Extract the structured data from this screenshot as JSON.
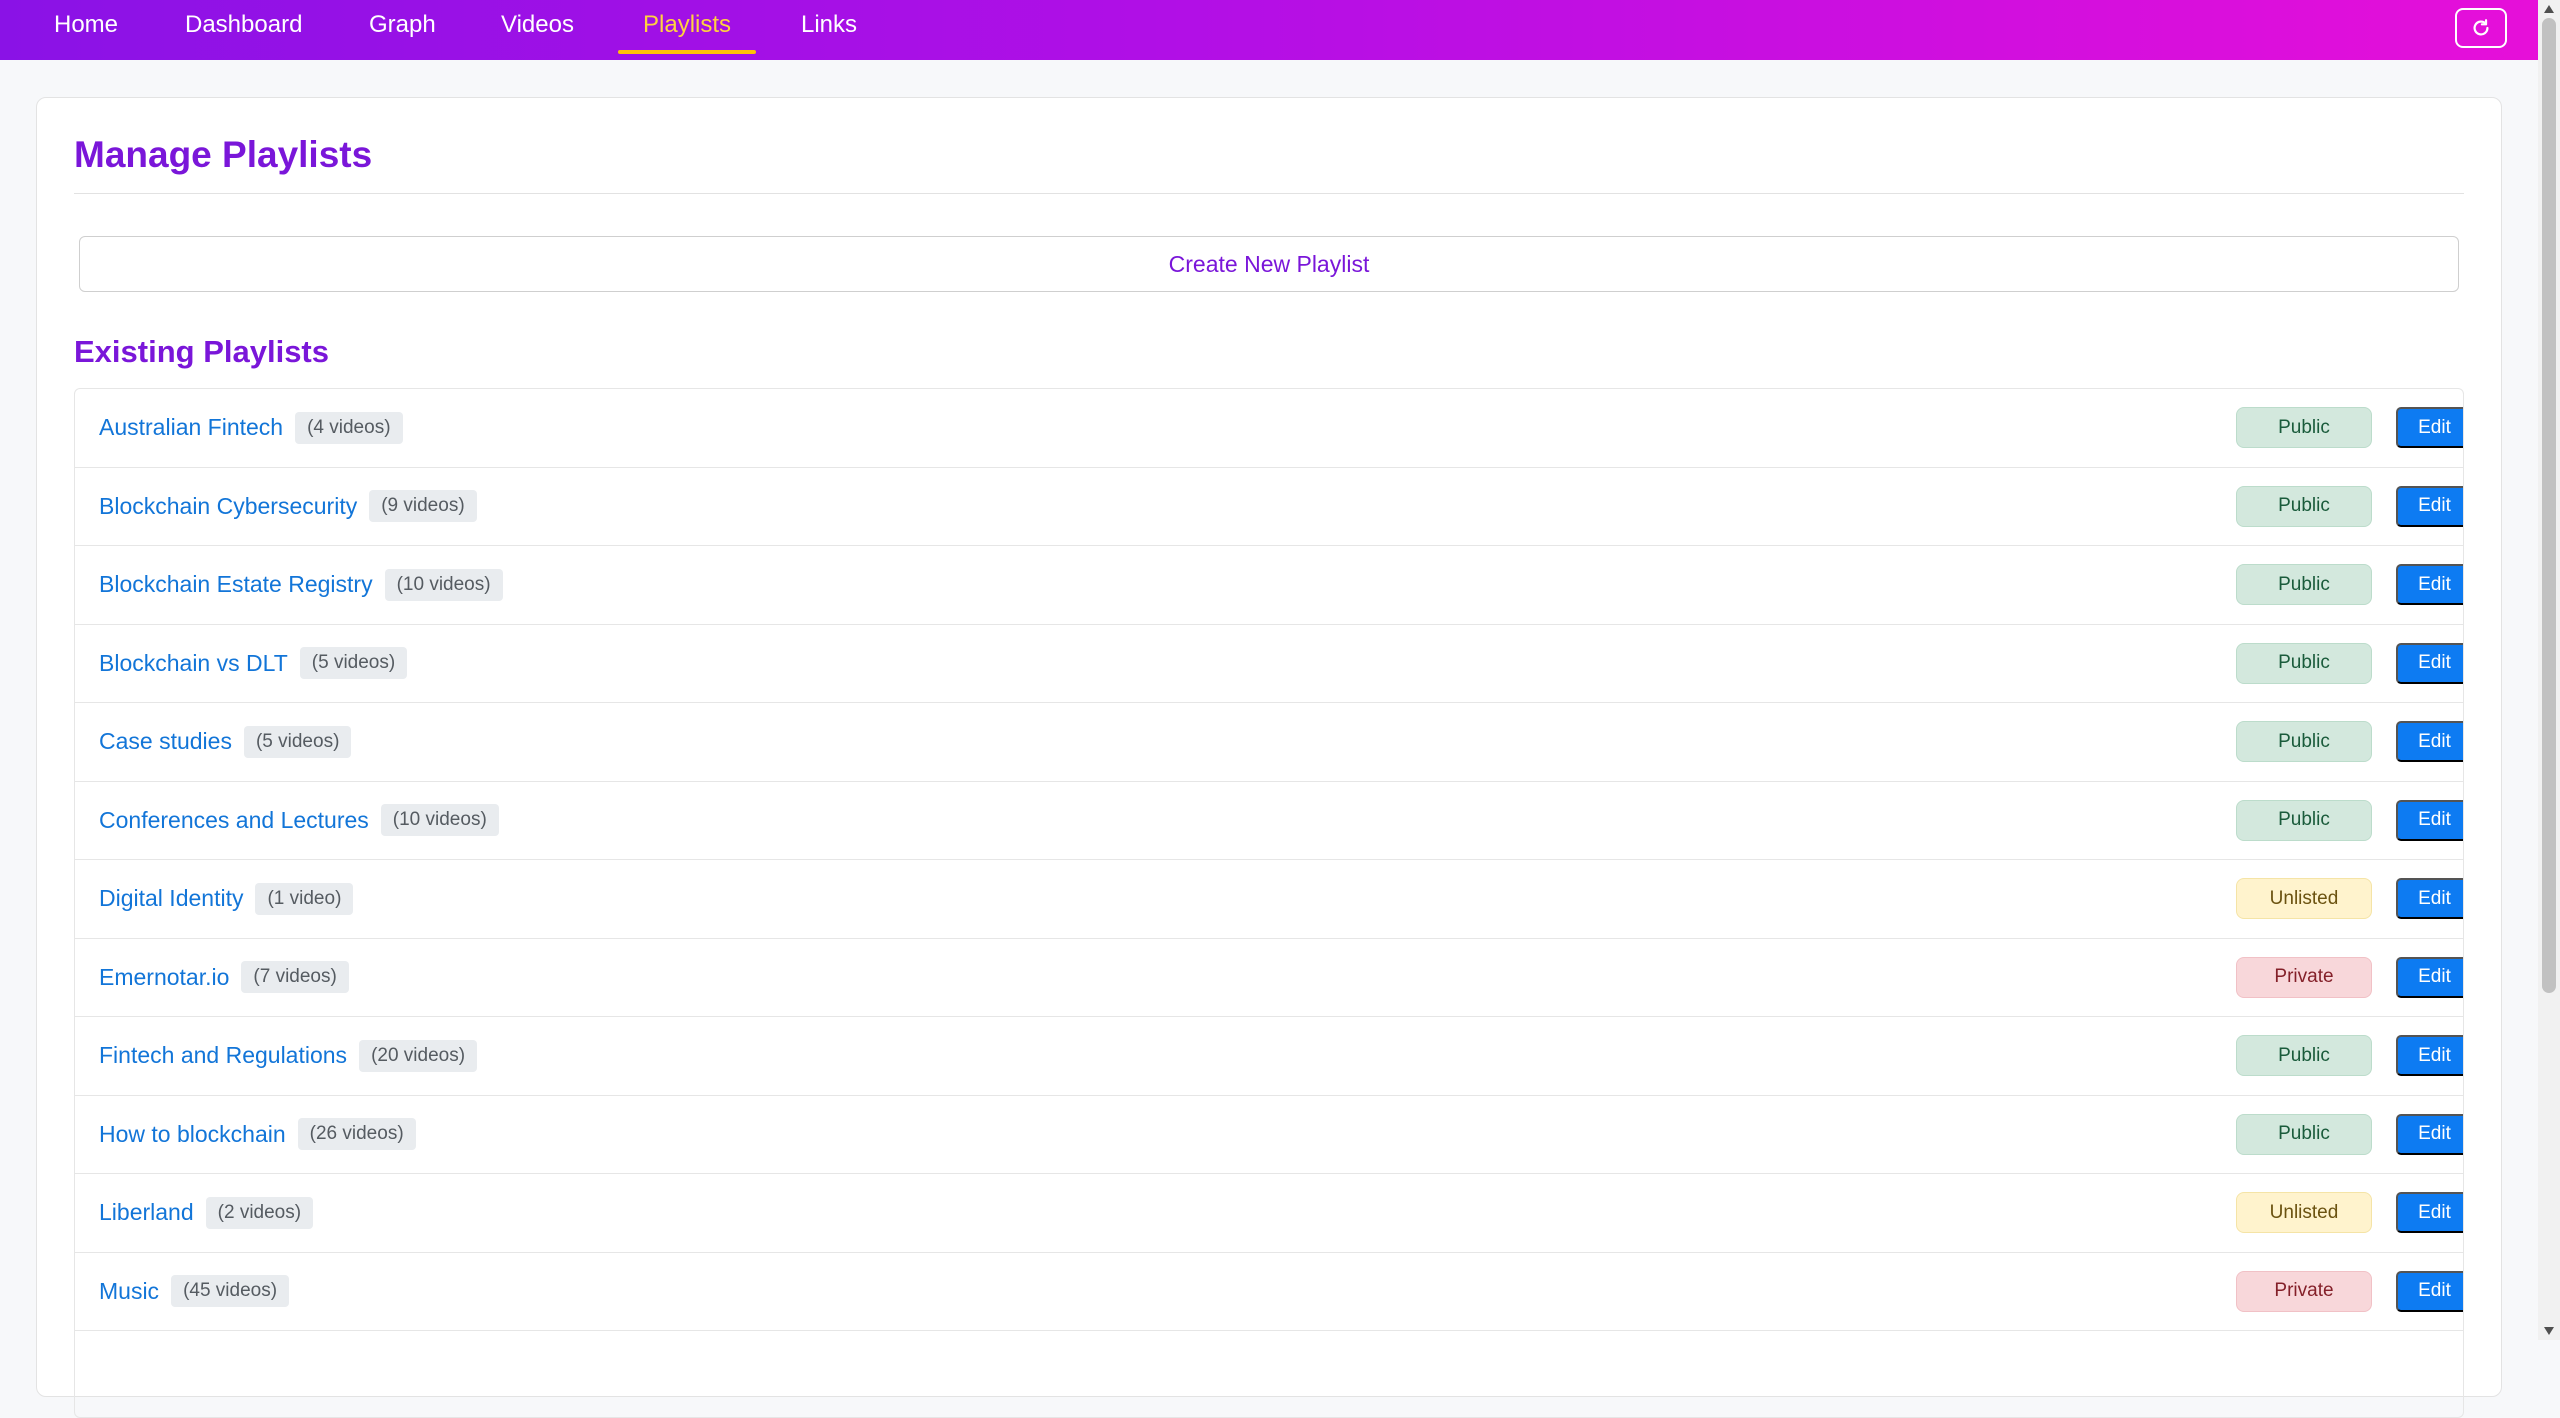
{
  "nav": {
    "items": [
      {
        "label": "Home",
        "active": false
      },
      {
        "label": "Dashboard",
        "active": false
      },
      {
        "label": "Graph",
        "active": false
      },
      {
        "label": "Videos",
        "active": false
      },
      {
        "label": "Playlists",
        "active": true
      },
      {
        "label": "Links",
        "active": false
      }
    ],
    "refresh_icon": "refresh-icon"
  },
  "page": {
    "title": "Manage Playlists",
    "create_label": "Create New Playlist",
    "section_title": "Existing Playlists"
  },
  "playlists": [
    {
      "name": "Australian Fintech",
      "count": "(4 videos)",
      "status": "Public",
      "status_kind": "public",
      "edit_label": "Edit"
    },
    {
      "name": "Blockchain Cybersecurity",
      "count": "(9 videos)",
      "status": "Public",
      "status_kind": "public",
      "edit_label": "Edit"
    },
    {
      "name": "Blockchain Estate Registry",
      "count": "(10 videos)",
      "status": "Public",
      "status_kind": "public",
      "edit_label": "Edit"
    },
    {
      "name": "Blockchain vs DLT",
      "count": "(5 videos)",
      "status": "Public",
      "status_kind": "public",
      "edit_label": "Edit"
    },
    {
      "name": "Case studies",
      "count": "(5 videos)",
      "status": "Public",
      "status_kind": "public",
      "edit_label": "Edit"
    },
    {
      "name": "Conferences and Lectures",
      "count": "(10 videos)",
      "status": "Public",
      "status_kind": "public",
      "edit_label": "Edit"
    },
    {
      "name": "Digital Identity",
      "count": "(1 video)",
      "status": "Unlisted",
      "status_kind": "unlisted",
      "edit_label": "Edit"
    },
    {
      "name": "Emernotar.io",
      "count": "(7 videos)",
      "status": "Private",
      "status_kind": "private",
      "edit_label": "Edit"
    },
    {
      "name": "Fintech and Regulations",
      "count": "(20 videos)",
      "status": "Public",
      "status_kind": "public",
      "edit_label": "Edit"
    },
    {
      "name": "How to blockchain",
      "count": "(26 videos)",
      "status": "Public",
      "status_kind": "public",
      "edit_label": "Edit"
    },
    {
      "name": "Liberland",
      "count": "(2 videos)",
      "status": "Unlisted",
      "status_kind": "unlisted",
      "edit_label": "Edit"
    },
    {
      "name": "Music",
      "count": "(45 videos)",
      "status": "Private",
      "status_kind": "private",
      "edit_label": "Edit"
    }
  ],
  "colors": {
    "accent": "#7a16d9",
    "link": "#1275d8",
    "edit_button": "#0d7bf2",
    "nav_active": "#ffc107"
  }
}
